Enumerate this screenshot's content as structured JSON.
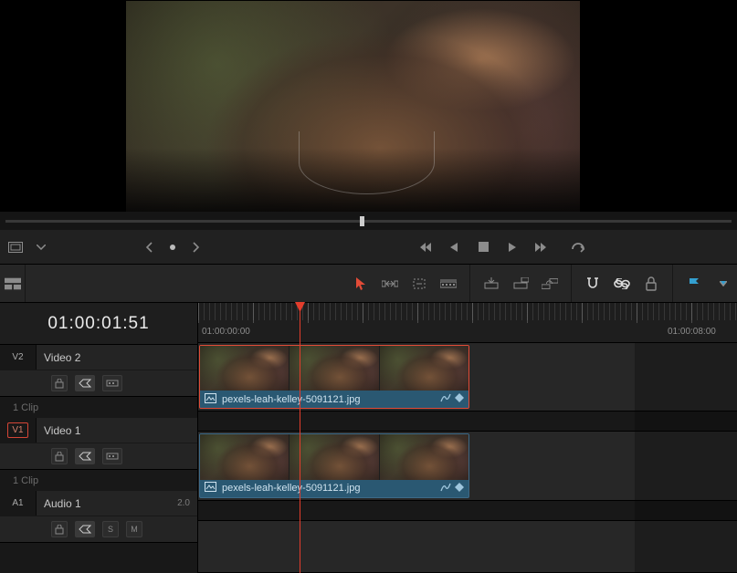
{
  "viewer": {
    "image_slug": "portrait-preview"
  },
  "transport": {
    "frame_mode": "crop-icon",
    "frame_dd": "chevron-down-icon",
    "pager_prev": "‹",
    "pager_dot": "•",
    "pager_next": "›"
  },
  "timecode": "01:00:01:51",
  "ruler": {
    "tc_a": "01:00:00:00",
    "tc_b": "01:00:08:00"
  },
  "tracks": {
    "v2": {
      "badge": "V2",
      "name": "Video 2",
      "clipcount": "1 Clip",
      "clip_name": "pexels-leah-kelley-5091121.jpg"
    },
    "v1": {
      "badge": "V1",
      "name": "Video 1",
      "clipcount": "1 Clip",
      "clip_name": "pexels-leah-kelley-5091121.jpg"
    },
    "a1": {
      "badge": "A1",
      "name": "Audio 1",
      "level": "2.0",
      "solo": "S",
      "mute": "M"
    }
  }
}
